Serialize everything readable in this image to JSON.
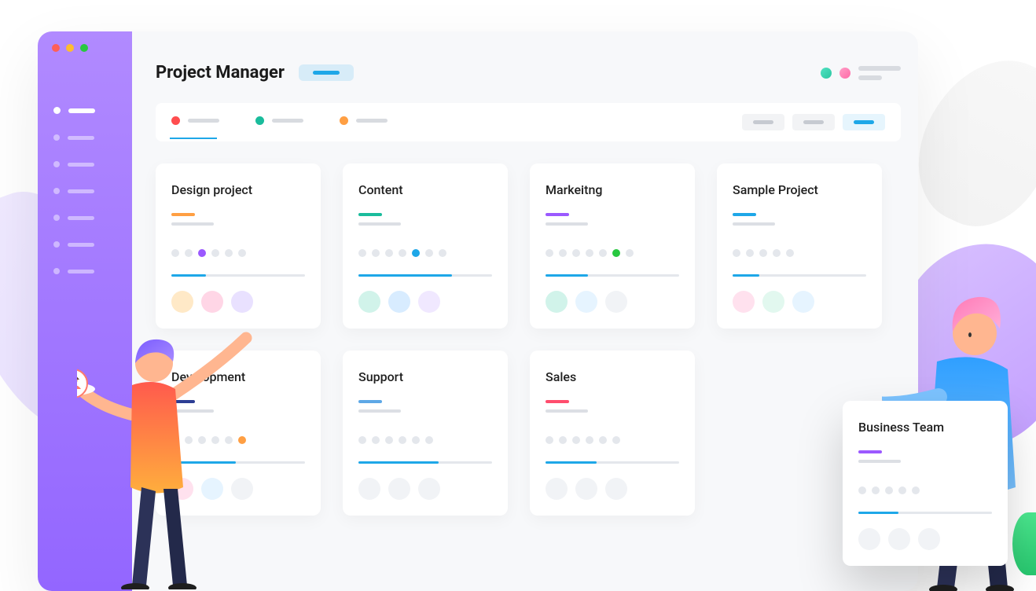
{
  "header": {
    "title": "Project Manager"
  },
  "tabs": {
    "colors": [
      "#ff4d4f",
      "#1abc9c",
      "#ff9f43"
    ]
  },
  "cards": [
    {
      "title": "Design project",
      "accent": "#ff9f43",
      "dots": [
        null,
        null,
        "#9b59ff",
        null,
        null,
        null
      ],
      "progress": 26,
      "circles": [
        "#ffe9c7",
        "#ffd6e6",
        "#e9e1ff"
      ]
    },
    {
      "title": "Content",
      "accent": "#1abc9c",
      "dots": [
        null,
        null,
        null,
        null,
        "#1ea7e8",
        null,
        null
      ],
      "progress": 70,
      "circles": [
        "#d1f3ea",
        "#d8ecff",
        "#f0e8ff"
      ]
    },
    {
      "title": "Markeitng",
      "accent": "#9b59ff",
      "dots": [
        null,
        null,
        null,
        null,
        null,
        "#28c840",
        null
      ],
      "progress": 32,
      "circles": [
        "#d1f3ea",
        "#e6f4ff",
        "#f1f3f6"
      ]
    },
    {
      "title": "Sample Project",
      "accent": "#1ea7e8",
      "dots": [
        null,
        null,
        null,
        null,
        null
      ],
      "progress": 20,
      "circles": [
        "#ffe1ee",
        "#e2f8ef",
        "#e6f4ff"
      ]
    },
    {
      "title": "Development",
      "accent": "#2c3e94",
      "dots": [
        null,
        null,
        null,
        null,
        null,
        "#ff9f43"
      ],
      "progress": 48,
      "circles": [
        "#ffe1ee",
        "#e6f4ff",
        "#f1f3f6"
      ]
    },
    {
      "title": "Support",
      "accent": "#5ea8e6",
      "dots": [
        null,
        null,
        null,
        null,
        null,
        null
      ],
      "progress": 60,
      "circles": [
        "#f1f3f6",
        "#f1f3f6",
        "#f1f3f6"
      ]
    },
    {
      "title": "Sales",
      "accent": "#ff4d6d",
      "dots": [
        null,
        null,
        null,
        null,
        null,
        null
      ],
      "progress": 38,
      "circles": [
        "#f1f3f6",
        "#f1f3f6",
        "#f1f3f6"
      ]
    }
  ],
  "float_card": {
    "title": "Business Team",
    "accent": "#9b59ff",
    "dots": [
      null,
      null,
      null,
      null,
      null
    ],
    "progress": 30,
    "circles": [
      "#f1f3f6",
      "#f1f3f6",
      "#f1f3f6"
    ]
  }
}
